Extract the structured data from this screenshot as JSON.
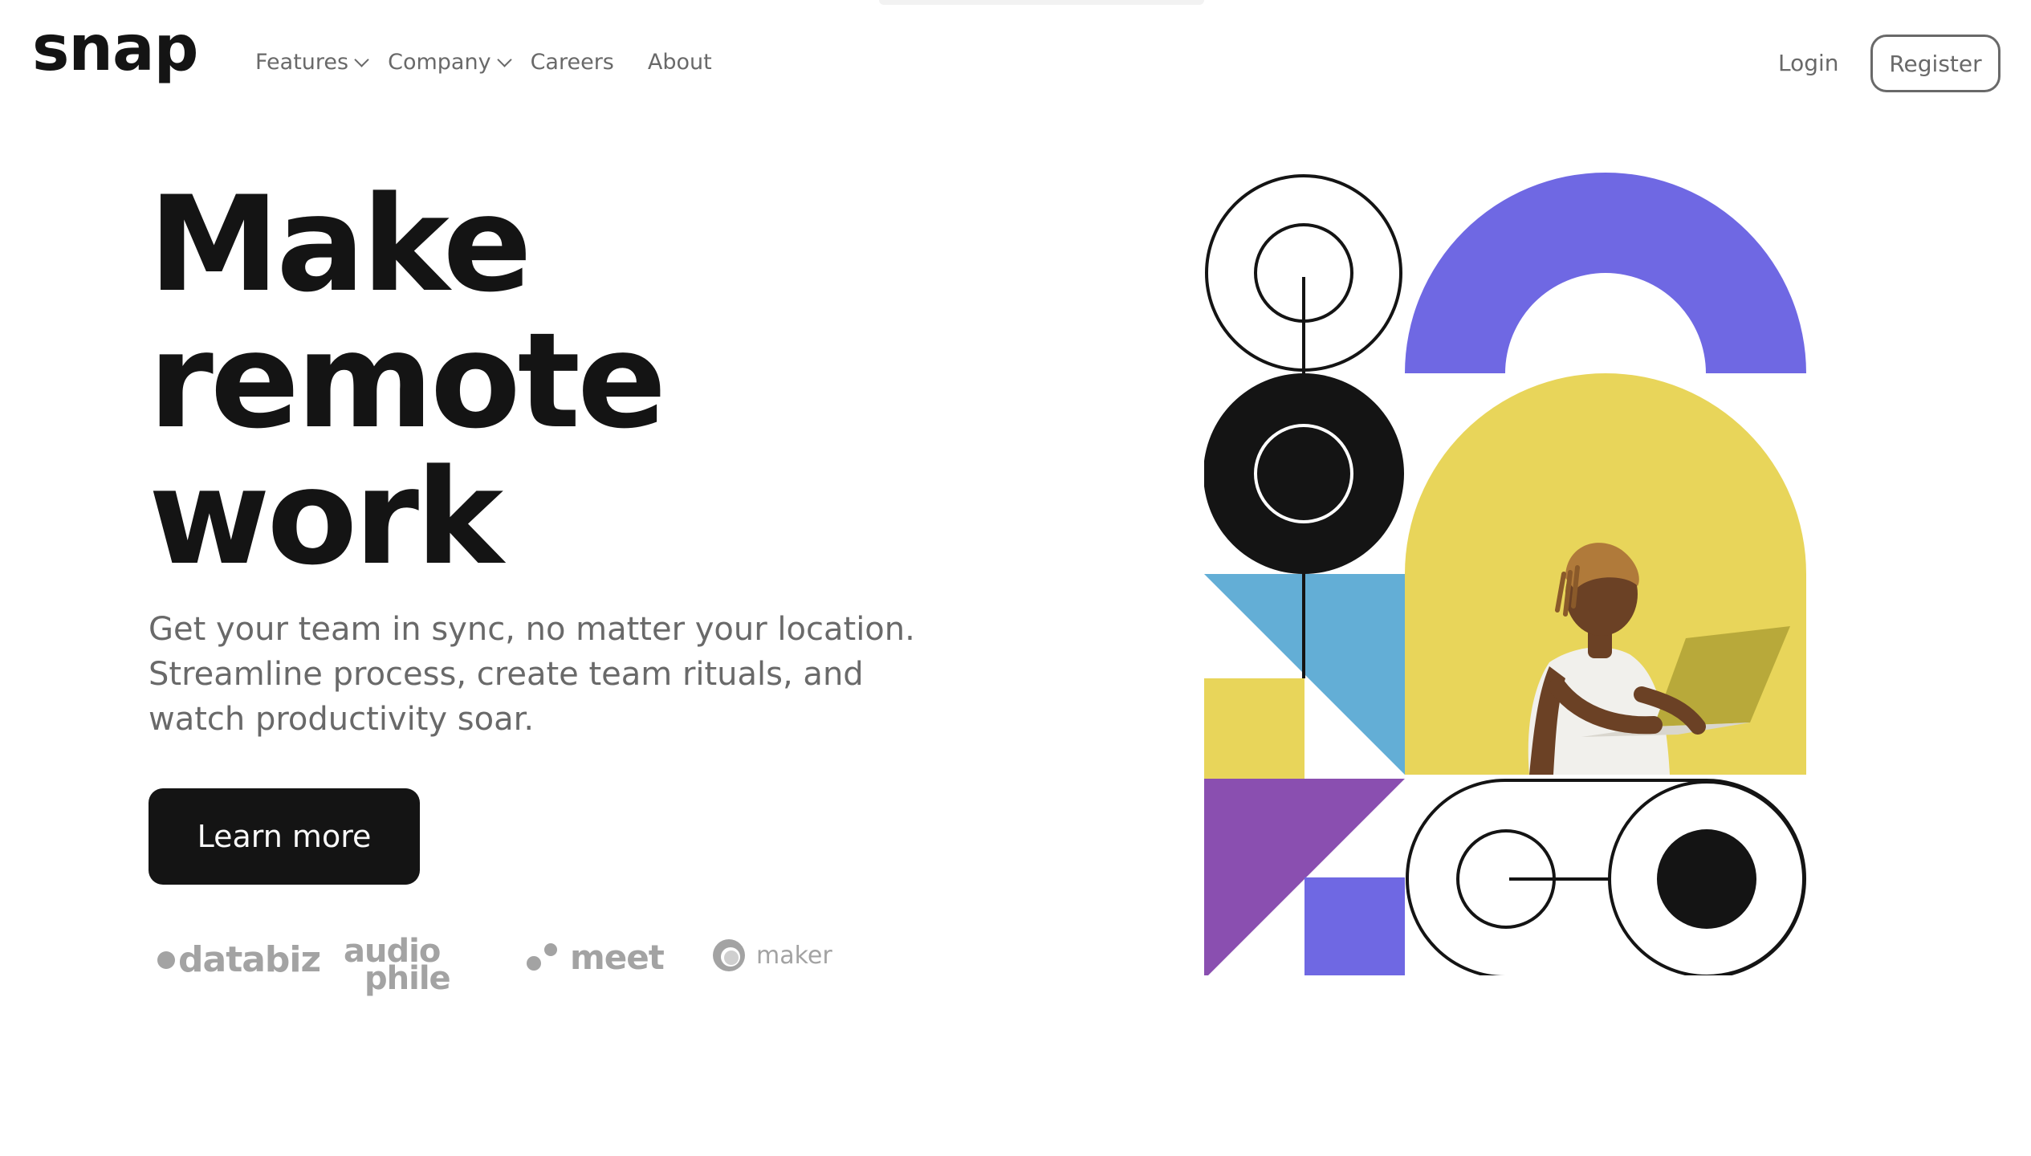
{
  "brand": {
    "logo_text": "snap"
  },
  "nav": {
    "items": [
      {
        "label": "Features",
        "has_dropdown": true
      },
      {
        "label": "Company",
        "has_dropdown": true
      },
      {
        "label": "Careers",
        "has_dropdown": false
      },
      {
        "label": "About",
        "has_dropdown": false
      }
    ],
    "login_label": "Login",
    "register_label": "Register"
  },
  "hero": {
    "title_lines": [
      "Make",
      "remote",
      "work"
    ],
    "subtitle": "Get your team in sync, no matter your location. Streamline process, create team rituals, and watch productivity soar.",
    "cta_label": "Learn more"
  },
  "clients": {
    "databiz": "databiz",
    "audiophile_line1": "audio",
    "audiophile_line2": "phile",
    "meet": "meet",
    "maker": "maker"
  },
  "colors": {
    "text_dark": "#141414",
    "text_gray": "#696969",
    "logo_gray": "#a3a3a3",
    "purple": "#6f68e3",
    "violet": "#8a4fb0",
    "blue": "#63aed6",
    "yellow": "#e8d55a",
    "white": "#ffffff"
  },
  "icons": {
    "dropdown": "chevron-down-icon",
    "databiz": "databiz-logo",
    "audiophile": "audiophile-logo",
    "meet": "meet-logo",
    "maker": "maker-logo"
  }
}
